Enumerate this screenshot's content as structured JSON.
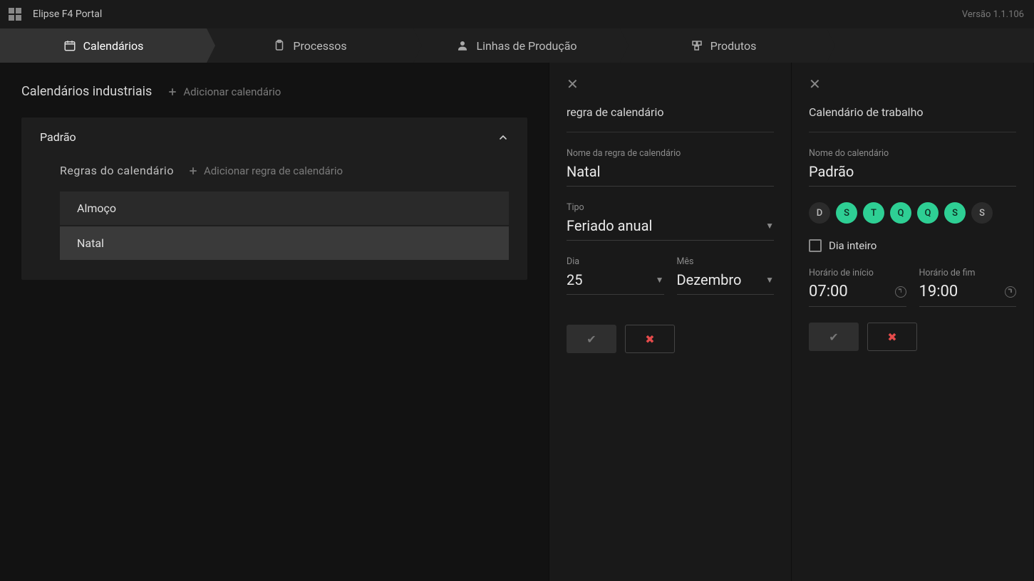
{
  "topbar": {
    "app_title": "Elipse F4 Portal",
    "version": "Versão 1.1.106"
  },
  "tabs": {
    "calendars": "Calendários",
    "processes": "Processos",
    "lines": "Linhas de Produção",
    "products": "Produtos"
  },
  "left": {
    "section_title": "Calendários industriais",
    "add_calendar": "Adicionar calendário",
    "calendar_name": "Padrão",
    "rules_title": "Regras do calendário",
    "add_rule": "Adicionar regra de calendário",
    "rules": [
      "Almoço",
      "Natal"
    ]
  },
  "rule_panel": {
    "title": "regra de calendário",
    "name_label": "Nome da regra de calendário",
    "name_value": "Natal",
    "type_label": "Tipo",
    "type_value": "Feriado anual",
    "day_label": "Dia",
    "day_value": "25",
    "month_label": "Mês",
    "month_value": "Dezembro"
  },
  "work_panel": {
    "title": "Calendário de trabalho",
    "name_label": "Nome do calendário",
    "name_value": "Padrão",
    "days": [
      {
        "label": "D",
        "on": false
      },
      {
        "label": "S",
        "on": true
      },
      {
        "label": "T",
        "on": true
      },
      {
        "label": "Q",
        "on": true
      },
      {
        "label": "Q",
        "on": true
      },
      {
        "label": "S",
        "on": true
      },
      {
        "label": "S",
        "on": false
      }
    ],
    "all_day_label": "Dia inteiro",
    "all_day_checked": false,
    "start_label": "Horário de início",
    "start_value": "07:00",
    "end_label": "Horário de fim",
    "end_value": "19:00"
  }
}
